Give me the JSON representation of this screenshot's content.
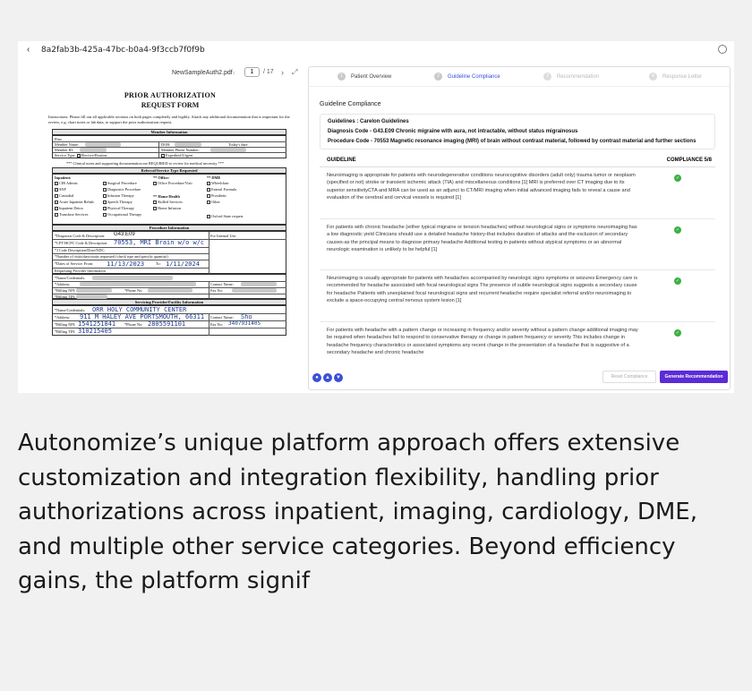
{
  "header": {
    "document_id": "8a2fab3b-425a-47bc-b0a4-9f3ccb7f0f9b"
  },
  "pdf": {
    "filename": "NewSampleAuth2.pdf",
    "page": "1",
    "page_total": "/ 17",
    "title": "PRIOR AUTHORIZATION",
    "subtitle": "REQUEST FORM",
    "instructions": "Instructions: Please fill out all applicable sections on both pages completely and legibly. Attach any additional documentation that is important for the review, e.g. chart notes or lab data, to support the prior authorization request.",
    "member_info": "Member Information",
    "plan": "Plan",
    "member_name": "Member Name:",
    "member_id": "Member ID:",
    "service_type": "Service Type:",
    "elective": "Elective/Routine",
    "expedited": "Expedited/Urgent",
    "dob": "DOB:",
    "todays_date": "Today's date:",
    "member_phone": "Member Phone Number:",
    "clinical_note": "*** Clinical notes and supporting documentation are REQUIRED to review for medical necessity ***",
    "referral": "Referral/Service Type Requested",
    "inpatient": "Inpatient:",
    "inpatient_items": [
      "CIR Admits",
      "SNF",
      "Custodial",
      "Acute Inpatient Rehab",
      "Inpatient Detox",
      "Transfuse Services"
    ],
    "outpatient_items": [
      "Surgical Procedure",
      "Diagnostic Procedure",
      "Infusion Therapy",
      "Speech Therapy",
      "Physical Therapy",
      "Occupational Therapy"
    ],
    "office": "** Office:",
    "office_item": "Office Procedure/Visit",
    "home_health": "** Home Health",
    "home_items": [
      "Skilled Services",
      "Home Infusion"
    ],
    "dme": "** DME",
    "dme_items": [
      "Wheelchair",
      "Enteral Formula",
      "Prosthetic",
      "Other"
    ],
    "oxford": "Oxford State request",
    "procedure_info": "Procedure Information",
    "diag_label": "*Diagnosis Code & Description:",
    "diag_value": "G43.E09",
    "cpt_label": "*CPT/HCPC Code & Description:",
    "cpt_value": "70553, MRI Brain w/o w/c",
    "jcode_label": "*J Code Description/Dose/NDC:",
    "visits_label": "*Number of visits/days/units requested (check type and specific quantity):",
    "dates_label": "*Dates of Service:",
    "from_label": "From:",
    "from_value": "11/13/2023",
    "to_label": "To:",
    "to_value": "1/11/2024",
    "requesting": "Requesting Provider Information",
    "name_cred": "*Name/Credentials:",
    "address": "*Address:",
    "billing_npi": "*Billing NPI:",
    "billing_tin": "*Billing TIN:",
    "phone": "*Phone No:",
    "fax": "Fax No:",
    "contact_name": "Contact Name:",
    "internal_use": "For Internal Use:",
    "servicing": "Servicing Provider/Facility Information",
    "s_name_value": "ORR HOLY COMMUNITY CENTER",
    "s_address_value": "911 M HALEY AVE PORTSMOUTH, 66311",
    "s_npi_value": "1541251841",
    "s_phone_value": "2805591101",
    "s_tin_value": "310215405",
    "s_fax_value": "3407931405",
    "s_contact_value": "Sho"
  },
  "steps": [
    {
      "num": "1",
      "label": "Patient Overview"
    },
    {
      "num": "2",
      "label": "Guideline Compliance"
    },
    {
      "num": "3",
      "label": "Recommendation"
    },
    {
      "num": "4",
      "label": "Response Letter"
    }
  ],
  "compliance": {
    "title": "Guideline Compliance",
    "guidelines": "Guidelines : Carelon Guidelines",
    "diagnosis": "Diagnosis Code - G43.E09 Chronic migraine with aura, not intractable, without status migrainosus",
    "procedure": "Procedure Code - 70553 Magnetic resonance imaging (MRI) of brain without contrast material, followed by contrast material and further sections",
    "col_guideline": "GUIDELINE",
    "col_compliance": "COMPLIANCE 5/8",
    "rows": [
      "Neuroimaging is appropriate for patients with neurodegenerative conditions neurocognitive disorders (adult only) trauma tumor or neoplasm (specified or not) stroke or transient ischemic attack (TIA) and miscellaneous conditions [1] MRI is preferred over CT imaging due to its superior sensitivityCTA and MRA can be used as an adjunct to CT/MRI imaging when initial advanced imaging fails to reveal a cause and evaluation of the cerebral and cervical vessels is required [1]",
      "For patients with chronic headache (either typical migraine or tension headaches) without neurological signs or symptoms neuroimaging has a low diagnostic yield Clinicians should use a detailed headache history-that includes duration of attacks and the exclusion of secondary causes-as the principal means to diagnose primary headache Additional testing in patients without atypical symptoms or an abnormal neurologic examination is unlikely to be helpful [1]",
      "Neuroimaging is usually appropriate for patients with headaches accompanied by neurologic signs symptoms or seizures Emergency care is recommended for headache associated with focal neurological signs The presence of subtle neurological signs suggests a secondary cause for headache Patients with unexplained focal neurological signs and recurrent headache require specialist referral and/or neuroimaging to exclude a space-occupying central nervous system lesion [1]",
      "For patients with headache with a pattern change or increasing in frequency and/or severity without a pattern change additional imaging may be required when headaches fail to respond to conservative therapy or change in pattern frequency or severity This includes change in headache frequency characteristics or associated symptoms any recent change in the presentation of a headache that is suggestive of a secondary headache and chronic headache"
    ],
    "reset_label": "Reset Compliance",
    "generate_label": "Generate Recommendation"
  },
  "caption": "Autonomize’s unique platform approach offers extensive customization and integration flexibility, handling prior authorizations across inpatient, imaging, cardiology, DME, and multiple other service categories. Beyond efficiency gains, the platform signif"
}
